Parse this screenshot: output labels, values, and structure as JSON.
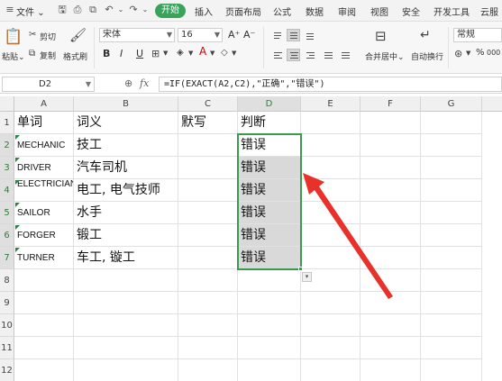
{
  "menubar": {
    "file_label": "文件",
    "file_dd": "⌄",
    "tabs": [
      {
        "label": "开始",
        "active": true
      },
      {
        "label": "插入"
      },
      {
        "label": "页面布局"
      },
      {
        "label": "公式"
      },
      {
        "label": "数据"
      },
      {
        "label": "审阅"
      },
      {
        "label": "视图"
      },
      {
        "label": "安全"
      },
      {
        "label": "开发工具"
      },
      {
        "label": "云服"
      }
    ],
    "quick_icons": [
      "save-icon",
      "print-icon",
      "print-preview-icon",
      "undo-icon",
      "undo-dropdown-icon",
      "redo-icon",
      "redo-dropdown-icon"
    ]
  },
  "ribbon": {
    "paste_label": "粘贴",
    "cut_label": "剪切",
    "copy_label": "复制",
    "format_painter_label": "格式刷",
    "font_name": "宋体",
    "font_size": "16",
    "grow_font": "A⁺",
    "shrink_font": "A⁻",
    "bold": "B",
    "italic": "I",
    "underline": "U",
    "merge_label": "合并居中",
    "wrap_label": "自动换行",
    "number_format": "常规",
    "percent_symbol": "%",
    "thousands_symbol": "000"
  },
  "formula_bar": {
    "name_box": "D2",
    "zoom_icon": "zoom-icon",
    "fx_label": "fx",
    "formula": "=IF(EXACT(A2,C2),\"正确\",\"错误\")"
  },
  "sheet": {
    "columns": [
      "A",
      "B",
      "C",
      "D",
      "E",
      "F",
      "G"
    ],
    "rows": [
      "1",
      "2",
      "3",
      "4",
      "5",
      "6",
      "7",
      "8",
      "9",
      "10",
      "11",
      "12"
    ],
    "active_cell": "D2",
    "header_row": {
      "A": "单词",
      "B": "词义",
      "C": "默写",
      "D": "判断"
    },
    "data_rows": [
      {
        "A": "MECHANIC",
        "B": "技工",
        "C": "",
        "D": "错误"
      },
      {
        "A": "DRIVER",
        "B": "汽车司机",
        "C": "",
        "D": "错误"
      },
      {
        "A": "ELECTRICIAN",
        "B": "电工, 电气技师",
        "C": "",
        "D": "错误"
      },
      {
        "A": "SAILOR",
        "B": "水手",
        "C": "",
        "D": "错误"
      },
      {
        "A": "FORGER",
        "B": "锻工",
        "C": "",
        "D": "错误"
      },
      {
        "A": "TURNER",
        "B": "车工, 镟工",
        "C": "",
        "D": "错误"
      }
    ],
    "selection_color": "#3a9a4f",
    "annotation_arrow_color": "#e8312b"
  }
}
